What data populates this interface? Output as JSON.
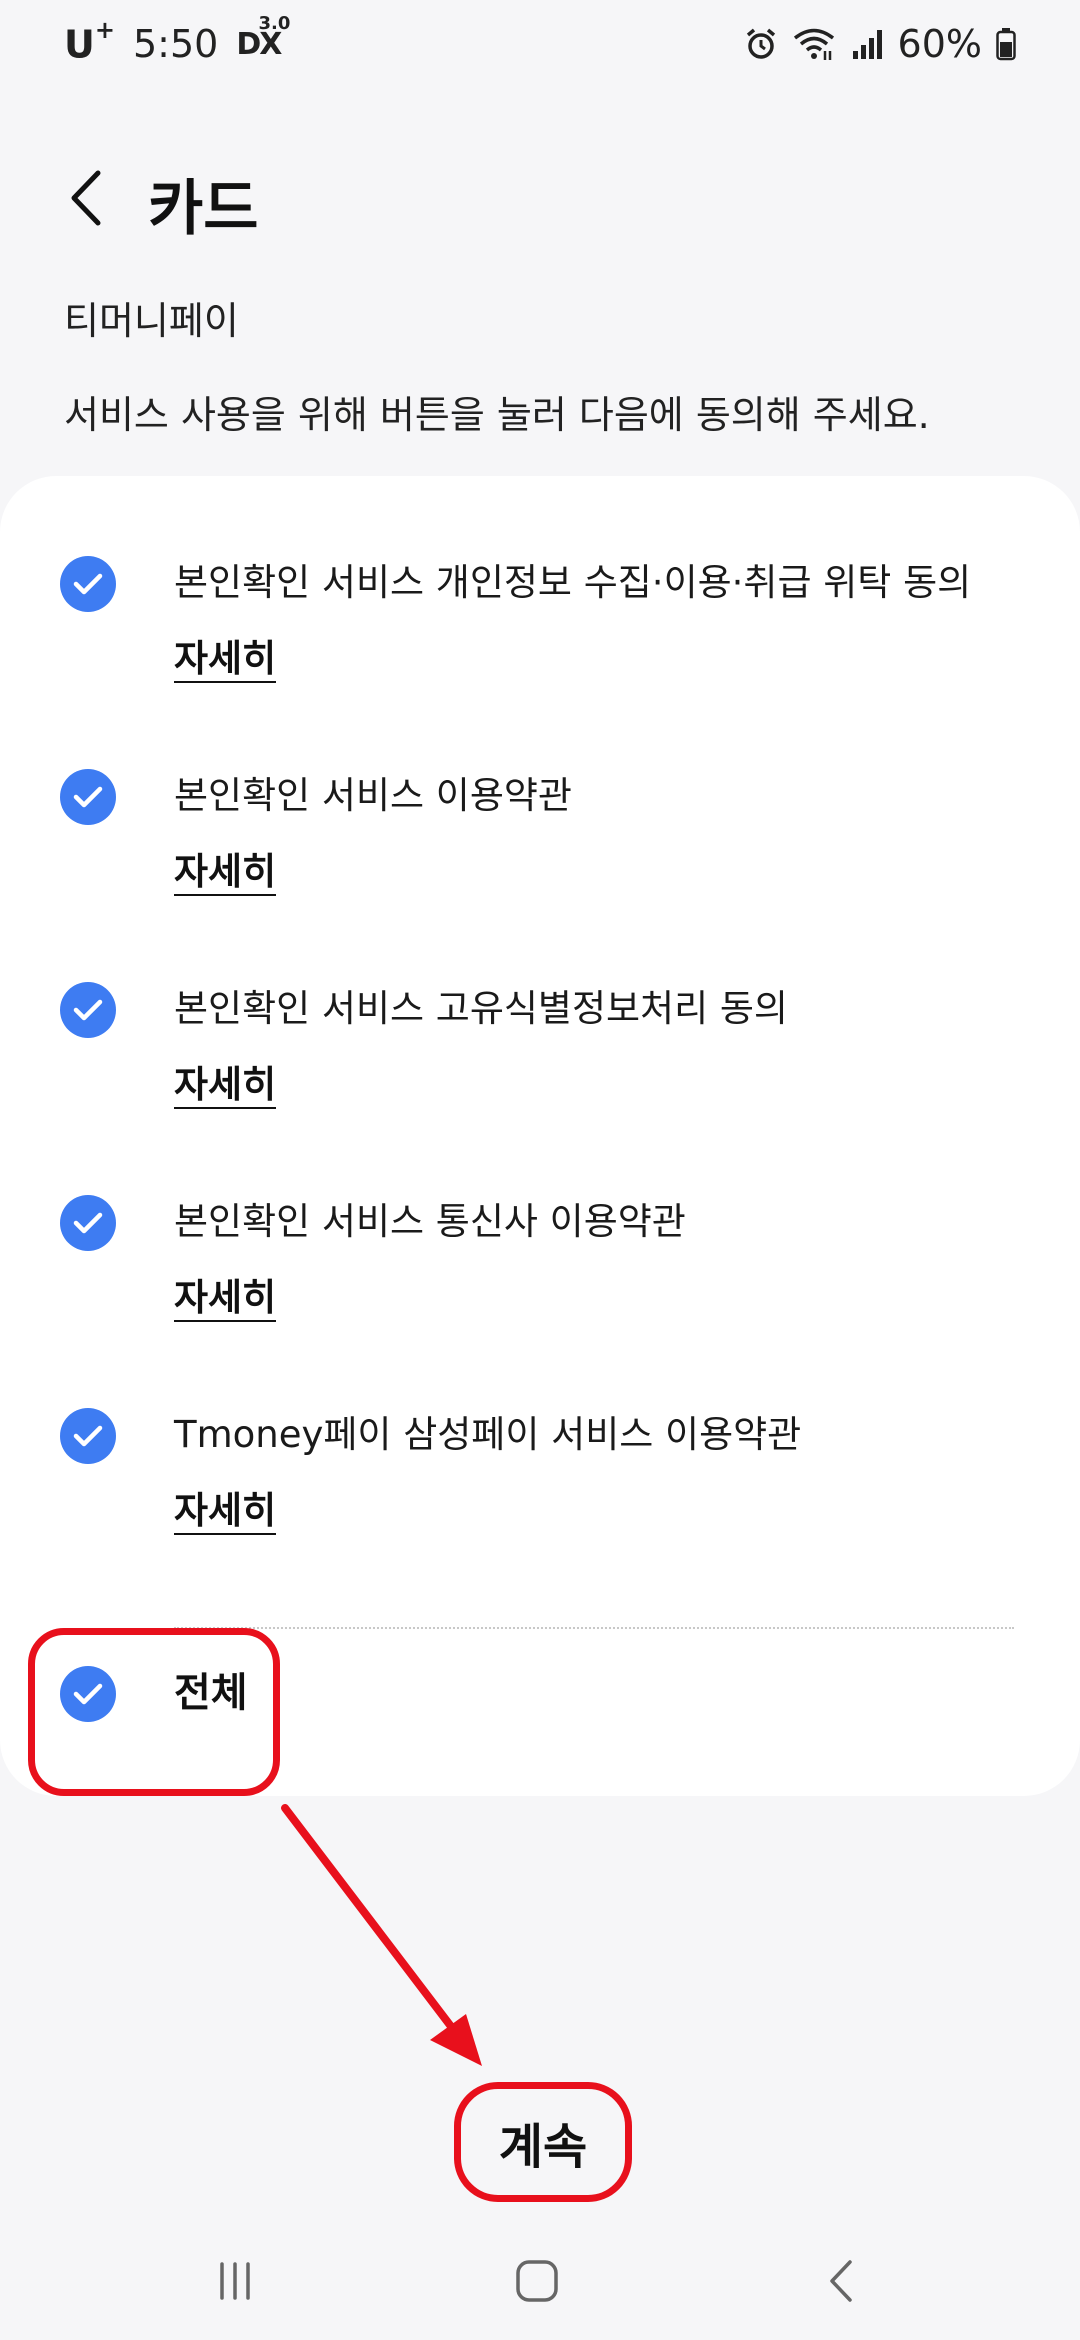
{
  "status_bar": {
    "carrier": "U",
    "carrier_sup": "+",
    "time": "5:50",
    "dx_label": "DX",
    "dx_version": "3.0",
    "battery": "60%",
    "icons": [
      "alarm-icon",
      "wifi-icon",
      "signal-icon",
      "battery-icon"
    ]
  },
  "header": {
    "title": "카드",
    "back_icon": "chevron-left-icon"
  },
  "subtitle": "티머니페이",
  "instruction": "서비스 사용을 위해 버튼을 눌러 다음에 동의해 주세요.",
  "consents": [
    {
      "label": "본인확인 서비스 개인정보 수집·이용·취급 위탁 동의",
      "detail": "자세히",
      "checked": true
    },
    {
      "label": "본인확인 서비스 이용약관",
      "detail": "자세히",
      "checked": true
    },
    {
      "label": "본인확인 서비스 고유식별정보처리 동의",
      "detail": "자세히",
      "checked": true
    },
    {
      "label": "본인확인 서비스 통신사 이용약관",
      "detail": "자세히",
      "checked": true
    },
    {
      "label": "Tmoney페이 삼성페이 서비스 이용약관",
      "detail": "자세히",
      "checked": true
    }
  ],
  "all_consent": {
    "label": "전체",
    "checked": true
  },
  "continue_label": "계속",
  "colors": {
    "check_blue": "#3e7cf2",
    "annotation_red": "#e8101c",
    "page_bg": "#f6f6f8",
    "card_bg": "#ffffff"
  },
  "nav": {
    "recent_icon": "recent-apps-icon",
    "home_icon": "home-icon",
    "back_icon": "back-icon"
  }
}
